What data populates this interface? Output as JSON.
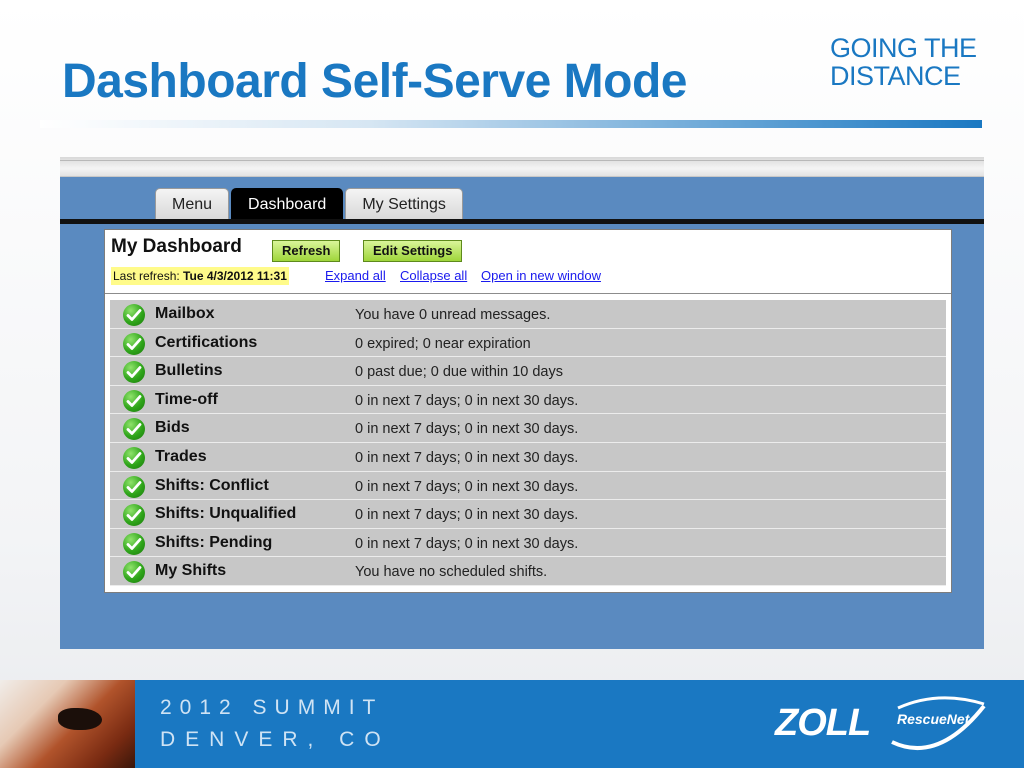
{
  "slide": {
    "title": "Dashboard Self-Serve Mode",
    "tagline_line1": "GOING THE",
    "tagline_line2": "DISTANCE"
  },
  "tabs": [
    {
      "label": "Menu",
      "active": false
    },
    {
      "label": "Dashboard",
      "active": true
    },
    {
      "label": "My Settings",
      "active": false
    }
  ],
  "dashboard": {
    "title": "My Dashboard",
    "refresh_label": "Refresh",
    "edit_settings_label": "Edit Settings",
    "last_refresh_label": "Last refresh:",
    "last_refresh_value": "Tue 4/3/2012 11:31",
    "links": {
      "expand_all": "Expand all",
      "collapse_all": "Collapse all",
      "open_new_window": "Open in new window"
    },
    "rows": [
      {
        "name": "Mailbox",
        "status": "You have 0 unread messages.",
        "icon": "check-icon"
      },
      {
        "name": "Certifications",
        "status": "0 expired; 0 near expiration",
        "icon": "check-icon"
      },
      {
        "name": "Bulletins",
        "status": "0 past due; 0 due within 10 days",
        "icon": "check-icon"
      },
      {
        "name": "Time-off",
        "status": "0 in next 7 days; 0 in next 30 days.",
        "icon": "check-icon"
      },
      {
        "name": "Bids",
        "status": "0 in next 7 days; 0 in next 30 days.",
        "icon": "check-icon"
      },
      {
        "name": "Trades",
        "status": "0 in next 7 days; 0 in next 30 days.",
        "icon": "check-icon"
      },
      {
        "name": "Shifts: Conflict",
        "status": "0 in next 7 days; 0 in next 30 days.",
        "icon": "check-icon"
      },
      {
        "name": "Shifts: Unqualified",
        "status": "0 in next 7 days; 0 in next 30 days.",
        "icon": "check-icon"
      },
      {
        "name": "Shifts: Pending",
        "status": "0 in next 7 days; 0 in next 30 days.",
        "icon": "check-icon"
      },
      {
        "name": "My Shifts",
        "status": "You have no scheduled shifts.",
        "icon": "check-icon"
      }
    ]
  },
  "footer": {
    "line1": "2012 SUMMIT",
    "line2": "DENVER, CO",
    "brand": "ZOLL",
    "product": "RescueNet"
  },
  "colors": {
    "accent_blue": "#1a78c2",
    "frame_blue": "#5a8ac0",
    "button_green": "#9fd63a",
    "highlight_yellow": "#fffb8a",
    "row_gray": "#c7c7c7"
  }
}
